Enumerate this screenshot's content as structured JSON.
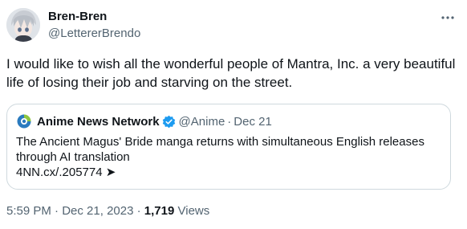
{
  "author": {
    "display_name": "Bren-Bren",
    "handle": "@LettererBrendo"
  },
  "tweet": {
    "text": "I would like to wish all the wonderful people of Mantra, Inc. a very beautiful life of losing their job and starving on the street.",
    "time": "5:59 PM",
    "separator": "·",
    "date": "Dec 21, 2023",
    "views_count": "1,719",
    "views_label": "Views"
  },
  "quote": {
    "name": "Anime News Network",
    "handle": "@Anime",
    "separator": "·",
    "date": "Dec 21",
    "text": "The Ancient Magus' Bride manga returns with simultaneous English releases through AI translation",
    "link": "4NN.cx/.205774 ➤"
  },
  "icons": {
    "more": "more-horizontal-icon",
    "verified": "verified-badge-icon",
    "quote_logo": "anime-news-network-logo"
  },
  "colors": {
    "text_primary": "#0f1419",
    "text_secondary": "#536471",
    "border": "#cfd9de",
    "verified": "#1d9bf0"
  }
}
